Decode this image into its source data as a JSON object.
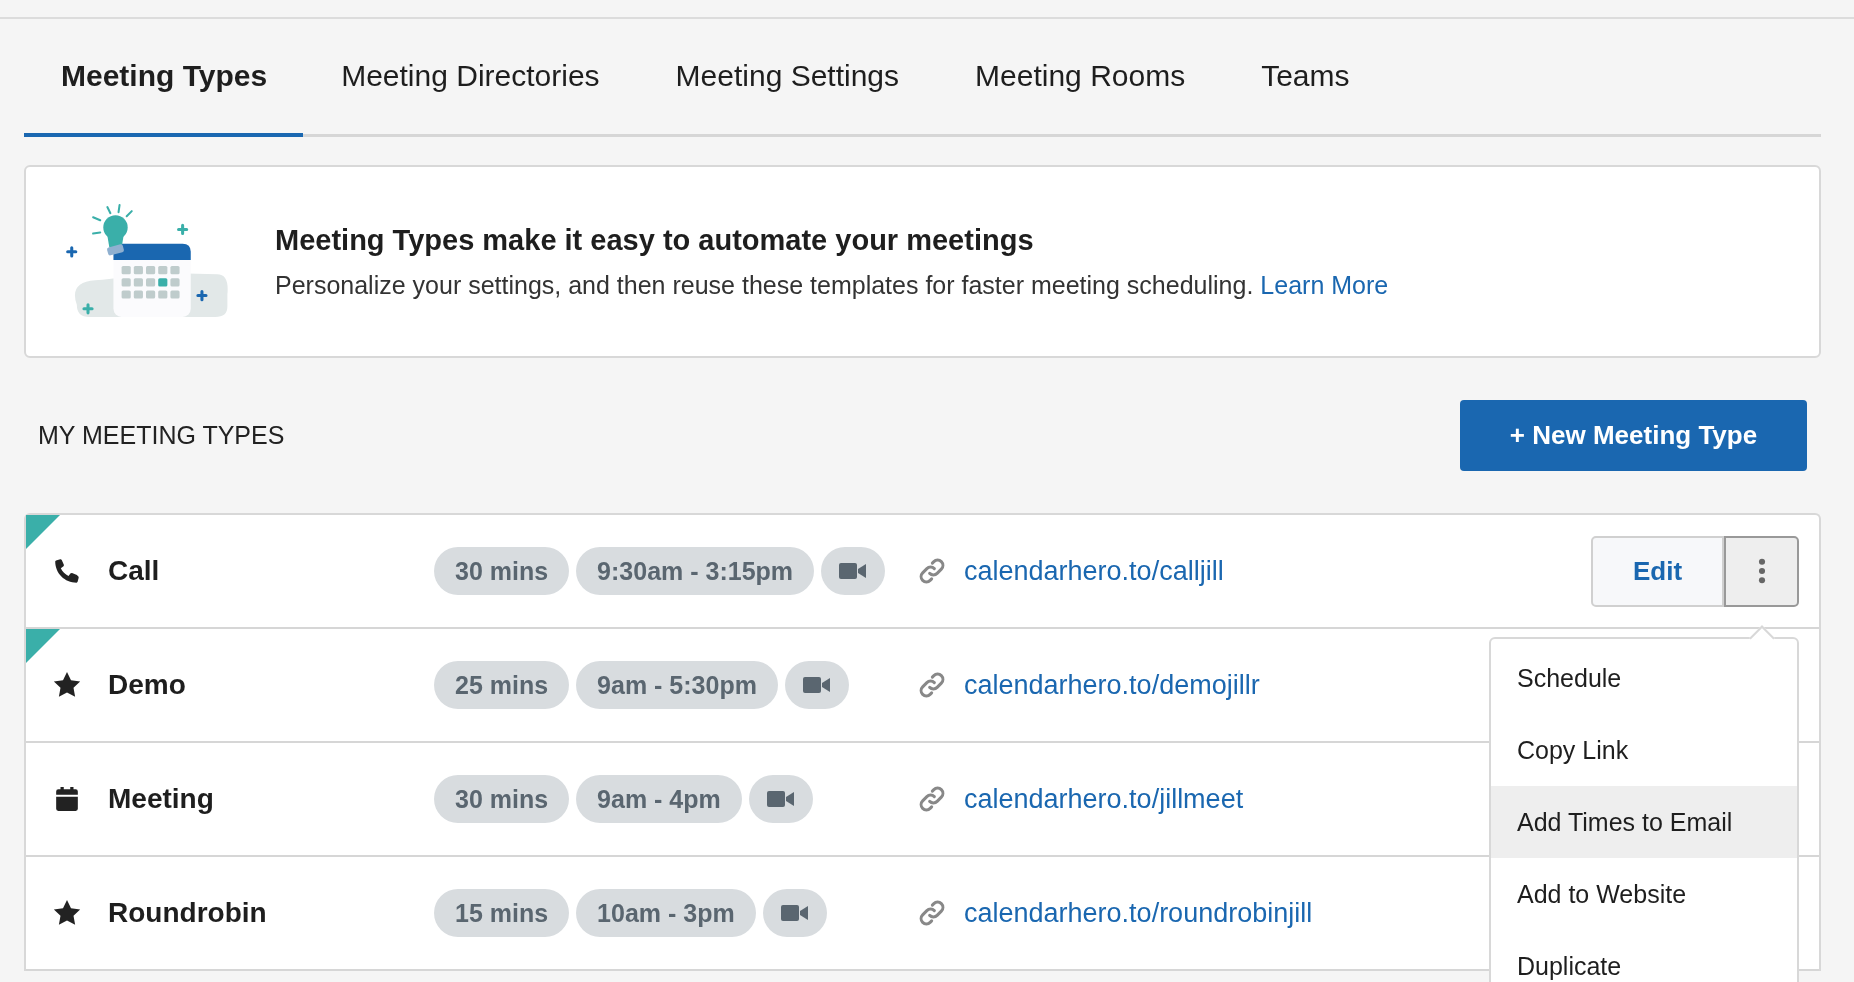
{
  "tabs": [
    {
      "label": "Meeting Types",
      "selected": true
    },
    {
      "label": "Meeting Directories",
      "selected": false
    },
    {
      "label": "Meeting Settings",
      "selected": false
    },
    {
      "label": "Meeting Rooms",
      "selected": false
    },
    {
      "label": "Teams",
      "selected": false
    }
  ],
  "banner": {
    "title": "Meeting Types make it easy to automate your meetings",
    "text": "Personalize your settings, and then reuse these templates for faster meeting scheduling.",
    "link": "Learn More"
  },
  "section": {
    "title": "MY MEETING TYPES",
    "new_button": "+ New Meeting Type"
  },
  "meeting_types": [
    {
      "kind": "phone",
      "name": "Call",
      "featured": true,
      "duration": "30 mins",
      "hours": "9:30am - 3:15pm",
      "video": true,
      "link": "calendarhero.to/calljill",
      "edit_button": "Edit",
      "menu": {
        "items": [
          {
            "label": "Schedule",
            "highlighted": false
          },
          {
            "label": "Copy Link",
            "highlighted": false
          },
          {
            "label": "Add Times to Email",
            "highlighted": true
          },
          {
            "label": "Add to Website",
            "highlighted": false
          },
          {
            "label": "Duplicate",
            "highlighted": false
          }
        ]
      }
    },
    {
      "kind": "star",
      "name": "Demo",
      "featured": true,
      "duration": "25 mins",
      "hours": "9am - 5:30pm",
      "video": true,
      "link": "calendarhero.to/demojillr"
    },
    {
      "kind": "calendar",
      "name": "Meeting",
      "featured": false,
      "duration": "30 mins",
      "hours": "9am - 4pm",
      "video": true,
      "link": "calendarhero.to/jillmeet"
    },
    {
      "kind": "star",
      "name": "Roundrobin",
      "featured": false,
      "duration": "15 mins",
      "hours": "10am - 3pm",
      "video": true,
      "link": "calendarhero.to/roundrobinjill"
    }
  ]
}
